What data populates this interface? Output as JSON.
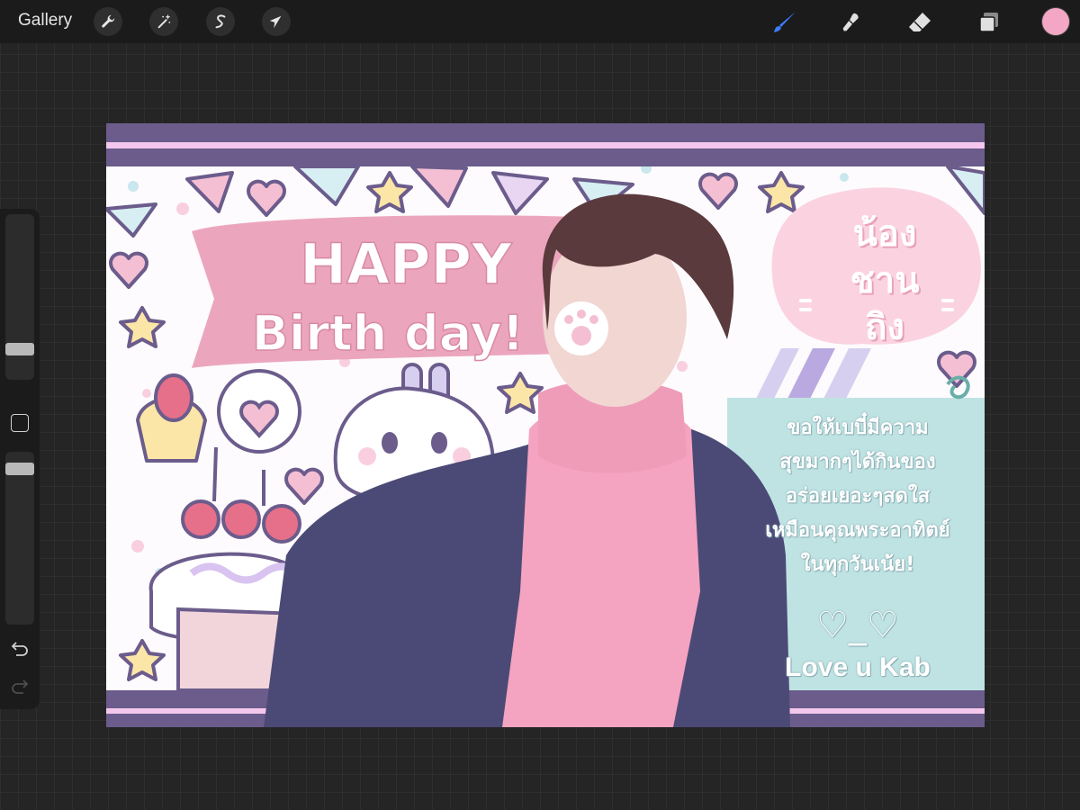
{
  "toolbar": {
    "gallery_label": "Gallery",
    "left_tools": [
      {
        "name": "wrench-icon"
      },
      {
        "name": "magic-wand-icon"
      },
      {
        "name": "selection-s-icon"
      },
      {
        "name": "transform-arrow-icon"
      }
    ],
    "right_tools": [
      {
        "name": "brush-icon",
        "active": true,
        "color": "#3d7cff"
      },
      {
        "name": "smudge-icon"
      },
      {
        "name": "eraser-icon"
      },
      {
        "name": "layers-icon"
      }
    ],
    "current_color": "#f3a7c5"
  },
  "sidebar": {
    "brush_size_slider": {
      "value": 0.4
    },
    "opacity_slider": {
      "value": 0.9
    },
    "icons": [
      "undo-icon",
      "redo-icon"
    ]
  },
  "artwork": {
    "banner_line1": "HAPPY",
    "banner_line2": "Birth day!",
    "bubble_lines": [
      "น้อง",
      "ชาน",
      "ถิง"
    ],
    "message_lines": [
      "ขอให้เบบี๋มีความ",
      "สุขมากๆได้กินของ",
      "อร่อยเยอะๆสดใส",
      "เหมือนคุณพระอาทิตย์",
      "ในทุกวันเน้ย!"
    ],
    "hearts_sign": "♡_♡",
    "love_sign": "Love u Kab",
    "colors": {
      "border_purple": "#6b5c8c",
      "pink_banner": "#eba6bd",
      "mint_panel": "#bfe3e3",
      "pink_bubble": "#fbd3e0",
      "jacket": "#4b4a76",
      "sweater": "#f4a3c0"
    }
  }
}
